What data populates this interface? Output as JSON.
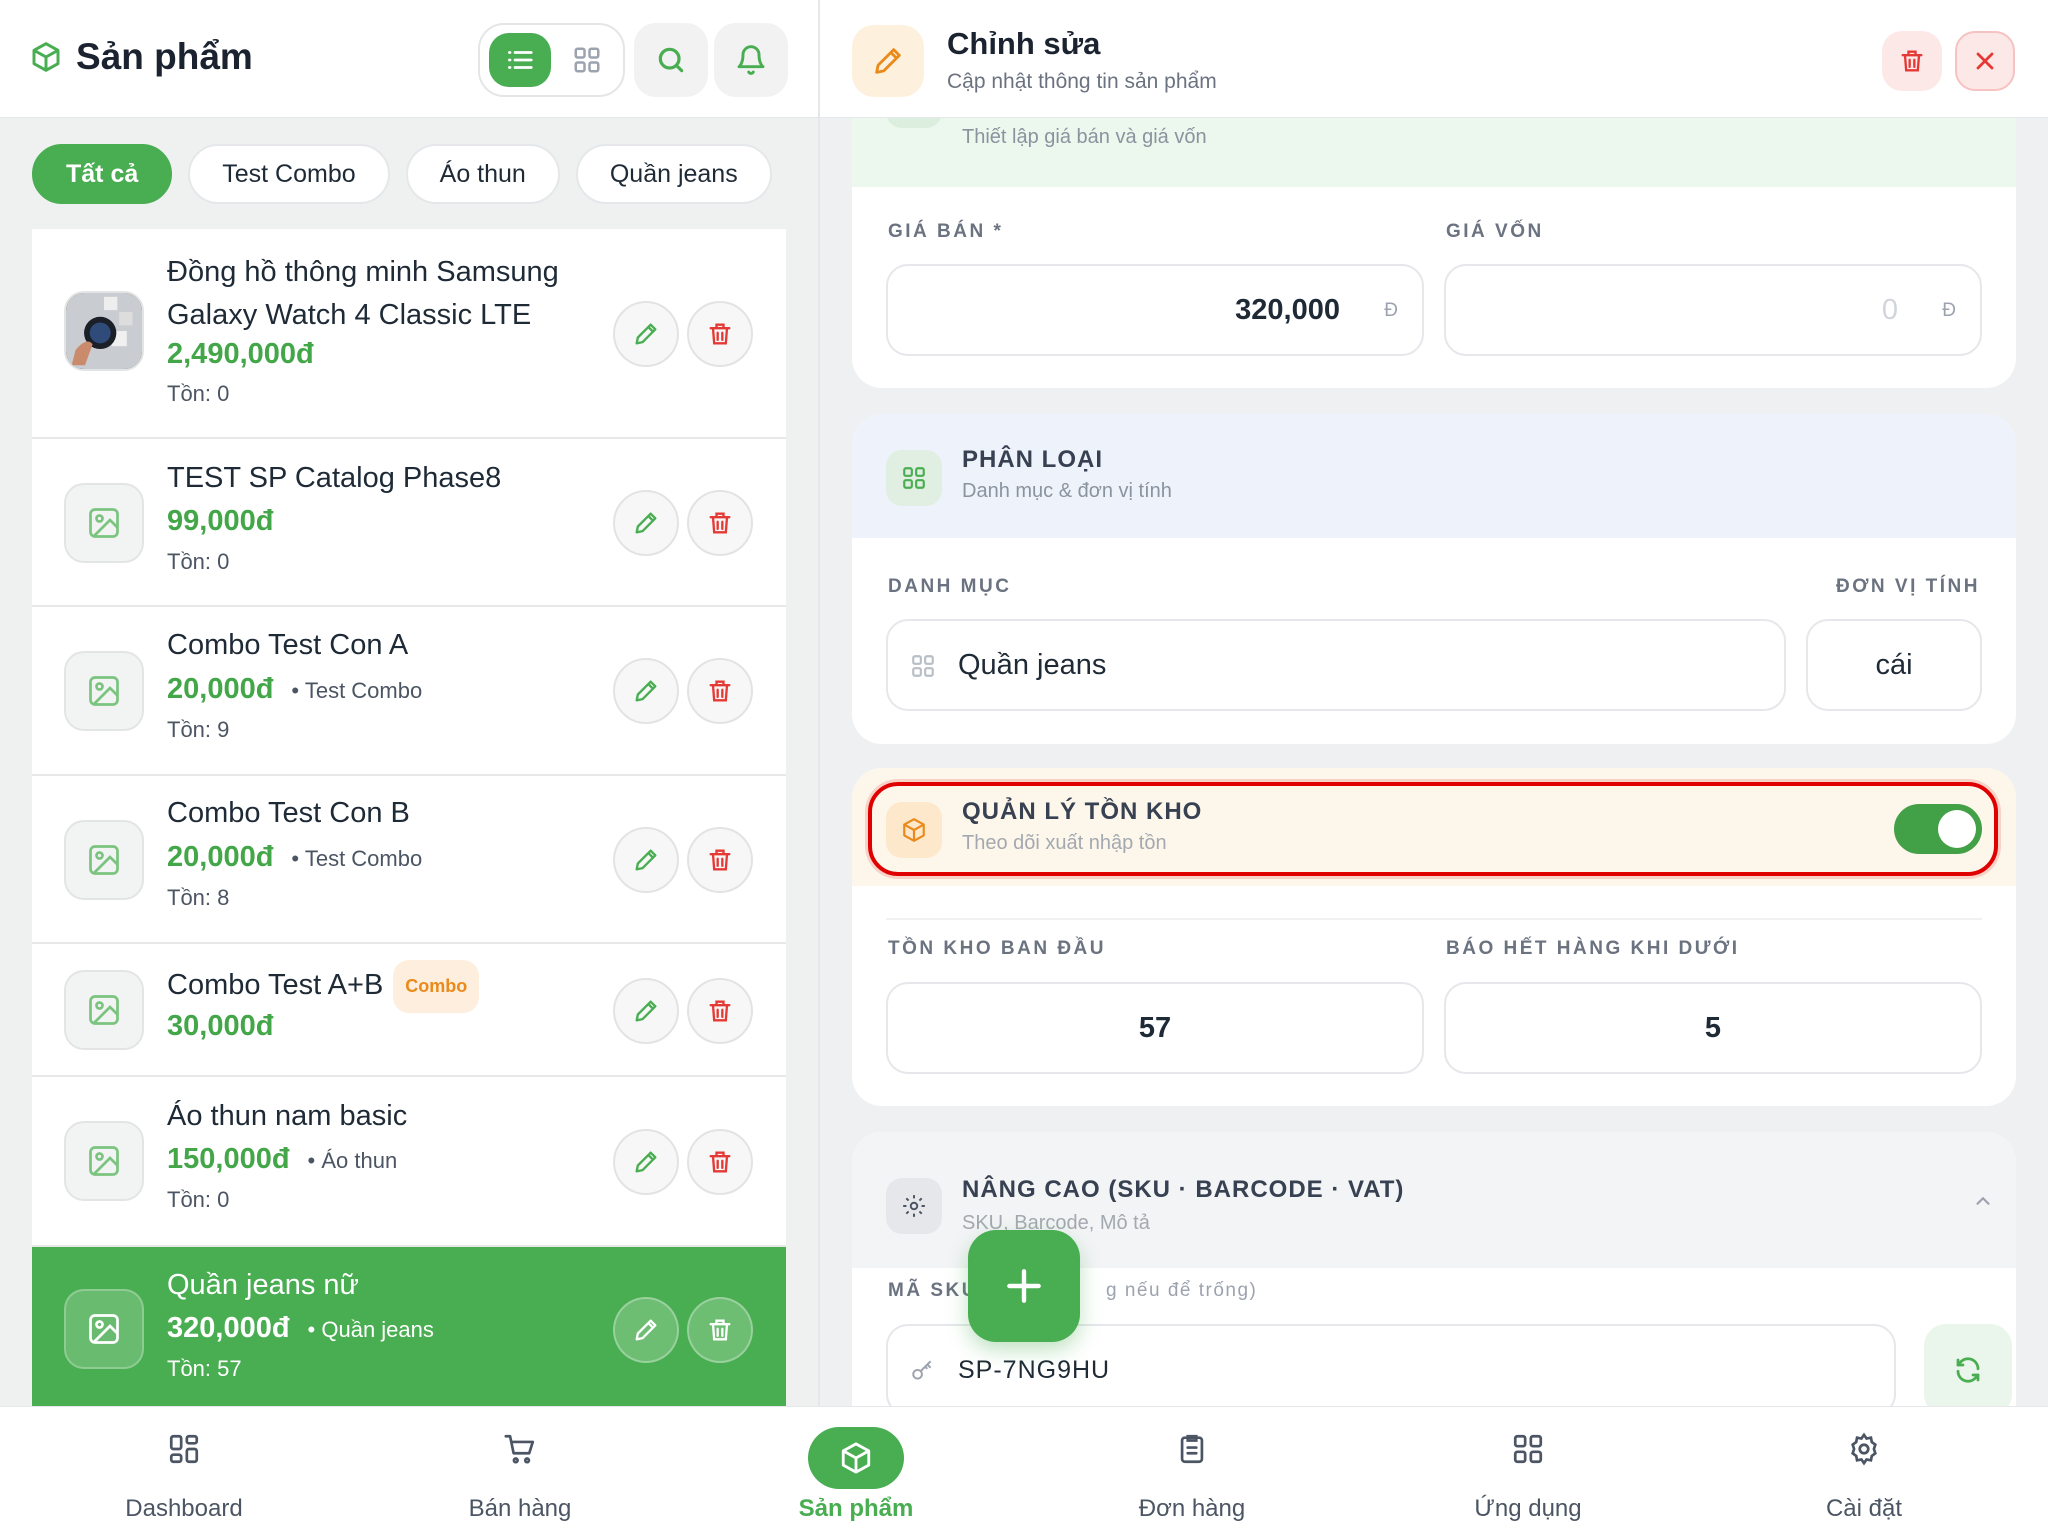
{
  "left": {
    "title": "Sản phẩm",
    "chips": [
      "Tất cả",
      "Test Combo",
      "Áo thun",
      "Quần jeans"
    ],
    "products": [
      {
        "name": "Đồng hồ thông minh Samsung Galaxy Watch 4 Classic LTE",
        "price": "2,490,000đ",
        "category": "",
        "tag": "",
        "stock": "Tồn: 0"
      },
      {
        "name": "TEST SP Catalog Phase8",
        "price": "99,000đ",
        "category": "",
        "tag": "",
        "stock": "Tồn: 0"
      },
      {
        "name": "Combo Test Con A",
        "price": "20,000đ",
        "category": "• Test Combo",
        "tag": "",
        "stock": "Tồn: 9"
      },
      {
        "name": "Combo Test Con B",
        "price": "20,000đ",
        "category": "• Test Combo",
        "tag": "",
        "stock": "Tồn: 8"
      },
      {
        "name": "Combo Test A+B",
        "price": "30,000đ",
        "category": "",
        "tag": "Combo",
        "stock": ""
      },
      {
        "name": "Áo thun nam basic",
        "price": "150,000đ",
        "category": "• Áo thun",
        "tag": "",
        "stock": "Tồn: 0"
      },
      {
        "name": "Quần jeans nữ",
        "price": "320,000đ",
        "category": "• Quần jeans",
        "tag": "",
        "stock": "Tồn: 57"
      }
    ]
  },
  "right": {
    "title": "Chỉnh sửa",
    "subtitle": "Cập nhật thông tin sản phẩm",
    "price_section": {
      "subtitle": "Thiết lập giá bán và giá vốn",
      "sell_label": "GIÁ BÁN *",
      "sell_value": "320,000",
      "cost_label": "GIÁ VỐN",
      "cost_placeholder": "0",
      "currency": "Đ"
    },
    "category_section": {
      "title": "PHÂN LOẠI",
      "subtitle": "Danh mục & đơn vị tính",
      "category_label": "DANH MỤC",
      "category_value": "Quần jeans",
      "unit_label": "ĐƠN VỊ TÍNH",
      "unit_value": "cái"
    },
    "inventory_section": {
      "title": "QUẢN LÝ TỒN KHO",
      "subtitle": "Theo dõi xuất nhập tồn",
      "enabled": true,
      "initial_label": "TỒN KHO BAN ĐẦU",
      "initial_value": "57",
      "alert_label": "BÁO HẾT HÀNG KHI DƯỚI",
      "alert_value": "5"
    },
    "advanced_section": {
      "title": "NÂNG CAO (SKU · BARCODE · VAT)",
      "subtitle": "SKU, Barcode, Mô tả",
      "sku_label_a": "MÃ SKU",
      "sku_label_b": "g nếu để trống)",
      "sku_value": "SP-7NG9HU"
    }
  },
  "nav": [
    "Dashboard",
    "Bán hàng",
    "Sản phẩm",
    "Đơn hàng",
    "Ứng dụng",
    "Cài đặt"
  ],
  "colors": {
    "accent": "#49ad51",
    "danger": "#e53935",
    "warning": "#ea8a1b",
    "highlight": "#e00000"
  }
}
